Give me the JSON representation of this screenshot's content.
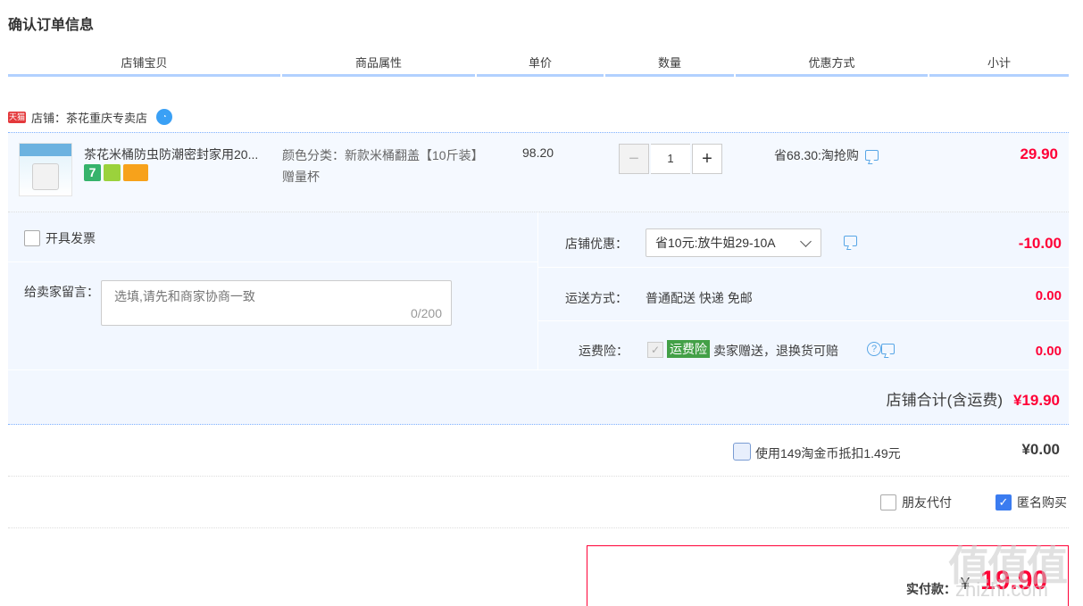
{
  "page": {
    "title": "确认订单信息"
  },
  "columns": [
    "店铺宝贝",
    "商品属性",
    "单价",
    "数量",
    "优惠方式",
    "小计"
  ],
  "shop": {
    "label": "店铺：茶花重庆专卖店",
    "badge_text": "天猫"
  },
  "item": {
    "name": "茶花米桶防虫防潮密封家用20...",
    "badge7": "7",
    "props": "颜色分类：新款米桶翻盖【10斤装】赠量杯",
    "unit_price": "98.20",
    "quantity": "1",
    "minus": "−",
    "plus": "+",
    "discount": "省68.30:淘抢购",
    "subtotal": "29.90"
  },
  "options": {
    "invoice_label": "开具发票",
    "message_label": "给卖家留言：",
    "message_placeholder": "选填,请先和商家协商一致",
    "message_count": "0/200",
    "shop_coupon_label": "店铺优惠：",
    "shop_coupon_value": "省10元:放牛姐29-10A",
    "shop_coupon_amount": "-10.00",
    "shipping_label": "运送方式：",
    "shipping_value": "普通配送 快递 免邮",
    "shipping_amount": "0.00",
    "insurance_label": "运费险：",
    "insurance_tag": "运费险",
    "insurance_text": "卖家赠送，退换货可赔",
    "insurance_amount": "0.00",
    "shop_total_label": "店铺合计(含运费)",
    "shop_total_amount": "¥19.90"
  },
  "coins": {
    "text": "使用149淘金币抵扣1.49元",
    "amount": "¥0.00"
  },
  "payment": {
    "friend_label": "朋友代付",
    "anonymous_label": "匿名购买",
    "check_mark": "✓"
  },
  "total": {
    "label": "实付款：",
    "currency": "¥",
    "amount": "19.90"
  },
  "watermark": {
    "main": "值值值",
    "sub": "zhizhi.com"
  }
}
